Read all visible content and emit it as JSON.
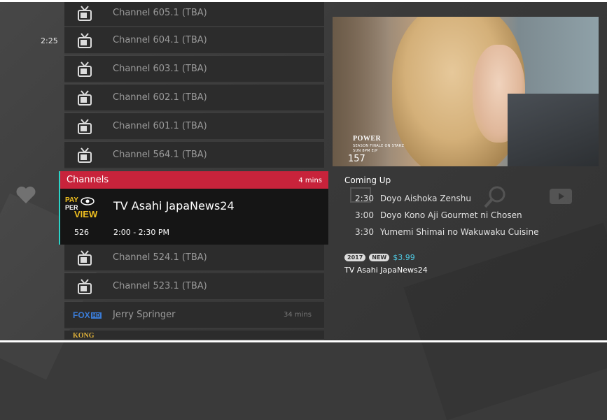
{
  "side": {
    "time": "2:25"
  },
  "channels_above": [
    {
      "name": "Channel 605.1 (TBA)"
    },
    {
      "name": "Channel 604.1 (TBA)"
    },
    {
      "name": "Channel 603.1 (TBA)"
    },
    {
      "name": "Channel 602.1 (TBA)"
    },
    {
      "name": "Channel 601.1 (TBA)"
    },
    {
      "name": "Channel 564.1 (TBA)"
    }
  ],
  "selected": {
    "header": "Channels",
    "header_time": "4 mins",
    "logo_icon": "pay-per-view-logo",
    "logo_text_top": "PAY",
    "logo_text_mid": "PER",
    "logo_text_bottom": "VIEW",
    "title": "TV Asahi JapaNews24",
    "number": "526",
    "time_range": "2:00 - 2:30 PM"
  },
  "channels_below": [
    {
      "name": "Channel 524.1 (TBA)"
    },
    {
      "name": "Channel 523.1 (TBA)"
    },
    {
      "name": "Jerry Springer",
      "duration": "34 mins",
      "logo": "FOX",
      "logo_box": "HD"
    },
    {
      "name": "",
      "logo": "KONG"
    }
  ],
  "preview": {
    "promo_title": "POWER",
    "promo_sub1": "SEASON FINALE ON STARZ",
    "promo_sub2": "SUN 8PM E/P",
    "channel_number": "157"
  },
  "coming_up": {
    "label": "Coming Up",
    "items": [
      {
        "time": "2:30",
        "title": "Doyo Aishoka Zenshu"
      },
      {
        "time": "3:00",
        "title": "Doyo Kono Aji Gourmet ni Chosen"
      },
      {
        "time": "3:30",
        "title": "Yumemi Shimai no Wakuwaku Cuisine"
      }
    ]
  },
  "details": {
    "year": "2017",
    "new_badge": "NEW",
    "price": "$3.99",
    "title": "TV Asahi JapaNews24"
  },
  "colors": {
    "accent_red": "#c8233b",
    "accent_teal": "#2ad4c8",
    "price_blue": "#4ec7e0"
  }
}
